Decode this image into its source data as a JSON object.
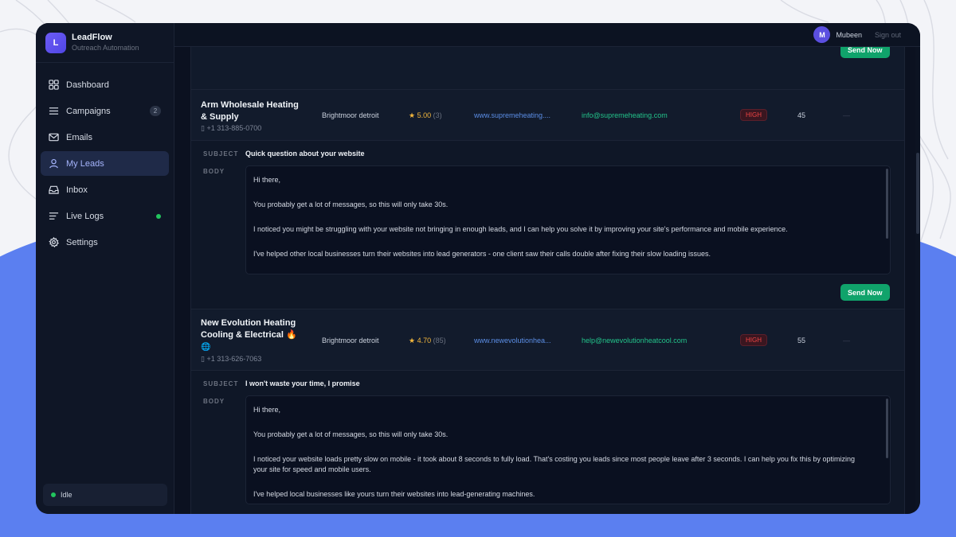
{
  "app": {
    "name": "LeadFlow",
    "subtitle": "Outreach Automation",
    "logo_letter": "L"
  },
  "sidebar": {
    "items": [
      {
        "label": "Dashboard",
        "icon": "grid-icon"
      },
      {
        "label": "Campaigns",
        "icon": "list-icon",
        "badge": "2"
      },
      {
        "label": "Emails",
        "icon": "mail-icon"
      },
      {
        "label": "My Leads",
        "icon": "user-icon",
        "active": true
      },
      {
        "label": "Inbox",
        "icon": "inbox-icon"
      },
      {
        "label": "Live Logs",
        "icon": "logs-icon",
        "live": true
      },
      {
        "label": "Settings",
        "icon": "gear-icon"
      }
    ],
    "status": "Idle"
  },
  "topbar": {
    "avatar_letter": "M",
    "username": "Mubeen",
    "signout": "Sign out"
  },
  "send_label": "Send Now",
  "labels": {
    "subject": "SUBJECT",
    "body": "BODY"
  },
  "leads": [
    {
      "name": "Arm Wholesale Heating & Supply",
      "phone": "▯ +1 313-885-0700",
      "location": "Brightmoor detroit",
      "rating": "★ 5.00",
      "rating_count": "(3)",
      "website": "www.supremeheating....",
      "email": "info@supremeheating.com",
      "priority": "HIGH",
      "score": "45",
      "extra": "—",
      "subject": "Quick question about your website",
      "body": [
        "Hi there,",
        "You probably get a lot of messages, so this will only take 30s.",
        "I noticed you might be struggling with your website not bringing in enough leads, and I can help you solve it by improving your site's performance and mobile experience.",
        "I've helped other local businesses turn their websites into lead generators - one client saw their calls double after fixing their slow loading issues."
      ]
    },
    {
      "name": "New Evolution Heating Cooling & Electrical 🔥",
      "name_extra": "🌐",
      "phone": "▯ +1 313-626-7063",
      "location": "Brightmoor detroit",
      "rating": "★ 4.70",
      "rating_count": "(85)",
      "website": "www.newevolutionhea...",
      "email": "help@newevolutionheatcool.com",
      "priority": "HIGH",
      "score": "55",
      "extra": "—",
      "subject": "I won't waste your time, I promise",
      "body": [
        "Hi there,",
        "You probably get a lot of messages, so this will only take 30s.",
        "I noticed your website loads pretty slow on mobile - it took about 8 seconds to fully load. That's costing you leads since most people leave after 3 seconds. I can help you fix this by optimizing your site for speed and mobile users.",
        "I've helped local businesses like yours turn their websites into lead-generating machines."
      ]
    }
  ],
  "colors": {
    "accent": "#5b4fe0",
    "send": "#10a36b",
    "high": "#ef4444",
    "link": "#5b8ee6",
    "email": "#23c38a"
  }
}
